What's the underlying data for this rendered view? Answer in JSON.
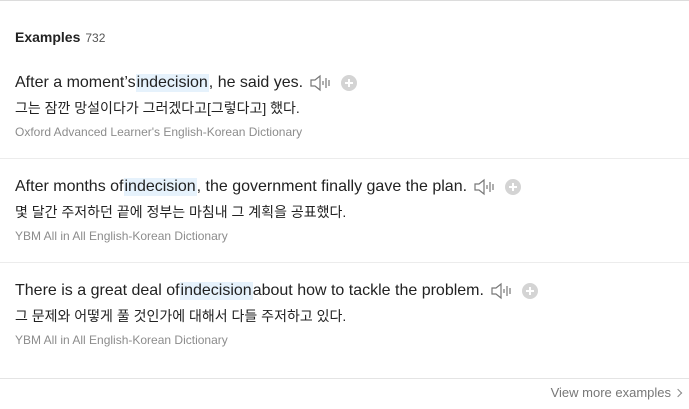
{
  "section": {
    "title": "Examples",
    "count": "732"
  },
  "examples": [
    {
      "en_before": "After a moment’s ",
      "en_highlight": "indecision",
      "en_after": ", he said yes.",
      "ko": "그는 잠깐 망설이다가 그러겠다고[그렇다고] 했다.",
      "source": "Oxford Advanced Learner's English-Korean Dictionary"
    },
    {
      "en_before": "After months of ",
      "en_highlight": "indecision",
      "en_after": ", the government finally gave the plan.",
      "ko": "몇 달간 주저하던 끝에 정부는 마침내 그 계획을 공표했다.",
      "source": "YBM All in All English-Korean Dictionary"
    },
    {
      "en_before": "There is a great deal of ",
      "en_highlight": "indecision",
      "en_after": " about how to tackle the problem.",
      "ko": "그 문제와 어떻게 풀 것인가에 대해서 다들 주저하고 있다.",
      "source": "YBM All in All English-Korean Dictionary"
    }
  ],
  "icons": {
    "speaker": "speaker-icon",
    "add": "plus-circle-icon",
    "more": "chevron-right-icon"
  },
  "colors": {
    "highlight": "#e6f2fc",
    "source_text": "#8c8c8c",
    "add_button": "#d4d4d4"
  },
  "footer": {
    "view_more_label": "View more examples"
  }
}
